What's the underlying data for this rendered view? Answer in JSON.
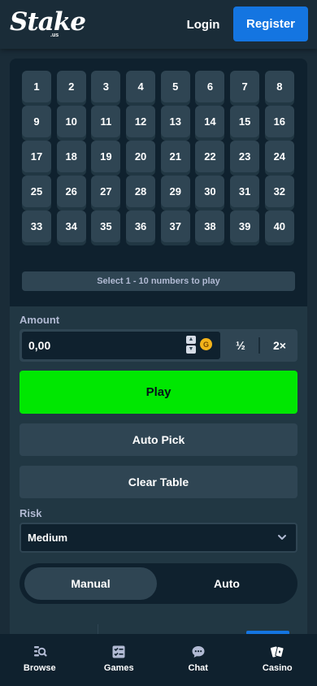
{
  "header": {
    "logo_text": "Stake",
    "logo_sub": ".us",
    "login_label": "Login",
    "register_label": "Register"
  },
  "grid": {
    "numbers": [
      "1",
      "2",
      "3",
      "4",
      "5",
      "6",
      "7",
      "8",
      "9",
      "10",
      "11",
      "12",
      "13",
      "14",
      "15",
      "16",
      "17",
      "18",
      "19",
      "20",
      "21",
      "22",
      "23",
      "24",
      "25",
      "26",
      "27",
      "28",
      "29",
      "30",
      "31",
      "32",
      "33",
      "34",
      "35",
      "36",
      "37",
      "38",
      "39",
      "40"
    ],
    "hint": "Select 1 - 10 numbers to play"
  },
  "controls": {
    "amount_label": "Amount",
    "amount_value": "0,00",
    "coin_symbol": "G",
    "half_label": "½",
    "double_label": "2×",
    "play_label": "Play",
    "auto_pick_label": "Auto Pick",
    "clear_table_label": "Clear Table",
    "risk_label": "Risk",
    "risk_value": "Medium",
    "mode_manual": "Manual",
    "mode_auto": "Auto",
    "active_mode": "Manual"
  },
  "bottom_nav": {
    "items": [
      {
        "label": "Browse",
        "icon": "browse-icon"
      },
      {
        "label": "Games",
        "icon": "games-icon"
      },
      {
        "label": "Chat",
        "icon": "chat-icon"
      },
      {
        "label": "Casino",
        "icon": "casino-icon"
      }
    ]
  },
  "colors": {
    "background": "#1a2c38",
    "panel_dark": "#0f212e",
    "panel_mid": "#213743",
    "tile": "#2f4553",
    "accent_blue": "#1475e1",
    "play_green": "#00e701",
    "muted_text": "#b1bad3"
  }
}
